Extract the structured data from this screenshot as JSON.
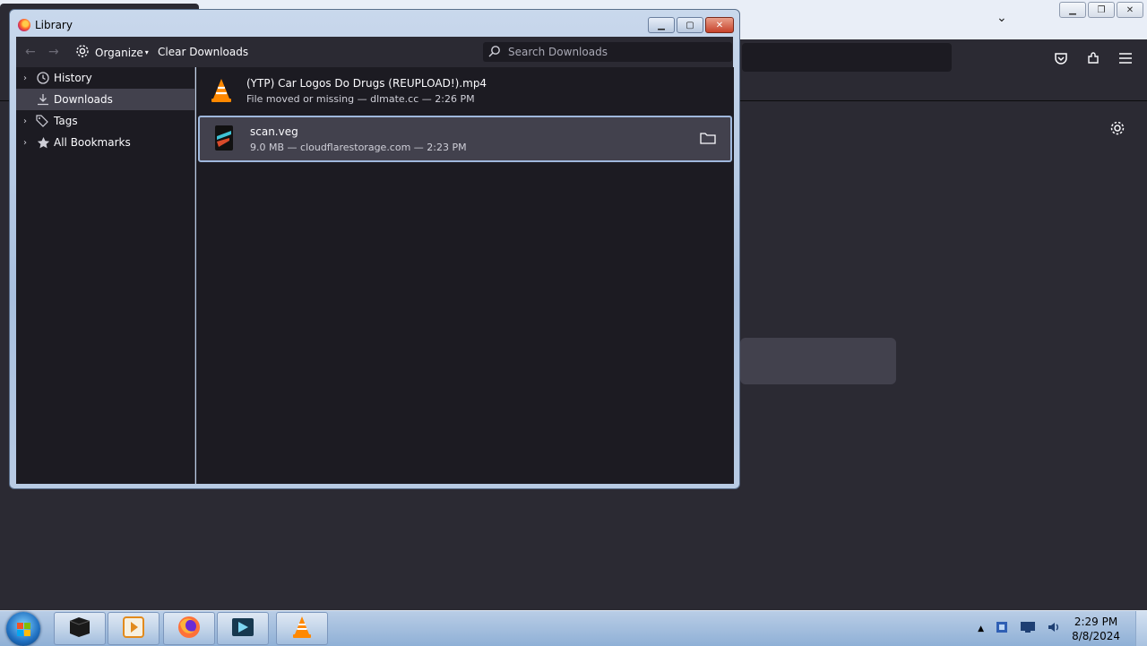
{
  "library": {
    "title": "Library",
    "toolbar": {
      "organize_label": "Organize",
      "clear_label": "Clear Downloads",
      "search_placeholder": "Search Downloads"
    },
    "sidebar": {
      "items": [
        {
          "label": "History",
          "icon": "clock-icon",
          "expandable": true
        },
        {
          "label": "Downloads",
          "icon": "download-icon",
          "expandable": false,
          "selected": true
        },
        {
          "label": "Tags",
          "icon": "tags-icon",
          "expandable": true
        },
        {
          "label": "All Bookmarks",
          "icon": "star-icon",
          "expandable": true
        }
      ]
    },
    "downloads": [
      {
        "name": "(YTP) Car Logos Do Drugs (REUPLOAD!).mp4",
        "status": "File moved or missing — dlmate.cc — 2:26 PM",
        "icon": "vlc-icon"
      },
      {
        "name": "scan.veg",
        "status": "9.0 MB — cloudflarestorage.com — 2:23 PM",
        "icon": "vegas-file-icon",
        "selected": true
      }
    ]
  },
  "taskbar": {
    "clock": {
      "time": "2:29 PM",
      "date": "8/8/2024"
    },
    "pinned": [
      "terminal-icon",
      "media-player-icon",
      "firefox-icon",
      "media-center-icon",
      "vlc-icon"
    ]
  }
}
